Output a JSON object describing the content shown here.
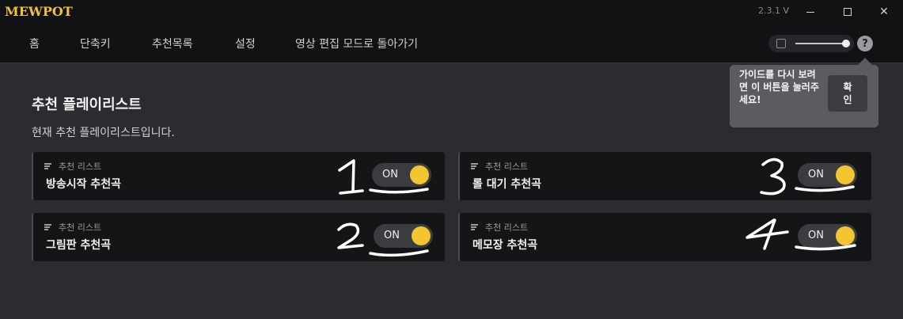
{
  "app": {
    "logo": "MEWPOT",
    "version": "2.3.1 V"
  },
  "window_controls": {
    "minimize_icon": "minimize-icon",
    "maximize_icon": "maximize-icon",
    "close_icon": "close-icon",
    "close_glyph": "✕"
  },
  "nav": {
    "items": [
      {
        "label": "홈"
      },
      {
        "label": "단축키"
      },
      {
        "label": "추천목록"
      },
      {
        "label": "설정"
      },
      {
        "label": "영상 편집 모드로 돌아가기"
      }
    ]
  },
  "zoom": {
    "level": 1.0
  },
  "help": {
    "glyph": "?"
  },
  "guide_popover": {
    "text": "가이드를 다시 보려면 이 버튼을 눌러주세요!",
    "confirm_label": "확인"
  },
  "page": {
    "title": "추천 플레이리스트",
    "subtitle": "현재 추천 플레이리스트입니다."
  },
  "playlists": [
    {
      "tag": "추천 리스트",
      "name": "방송시작 추천곡",
      "toggle": "ON",
      "annotation": "1"
    },
    {
      "tag": "추천 리스트",
      "name": "롤 대기 추천곡",
      "toggle": "ON",
      "annotation": "3"
    },
    {
      "tag": "추천 리스트",
      "name": "그림판 추천곡",
      "toggle": "ON",
      "annotation": "2"
    },
    {
      "tag": "추천 리스트",
      "name": "메모장 추천곡",
      "toggle": "ON",
      "annotation": "4"
    }
  ],
  "colors": {
    "accent": "#f3c531",
    "background": "#2b2c2f",
    "titlebar": "#111213",
    "card": "#141516"
  }
}
